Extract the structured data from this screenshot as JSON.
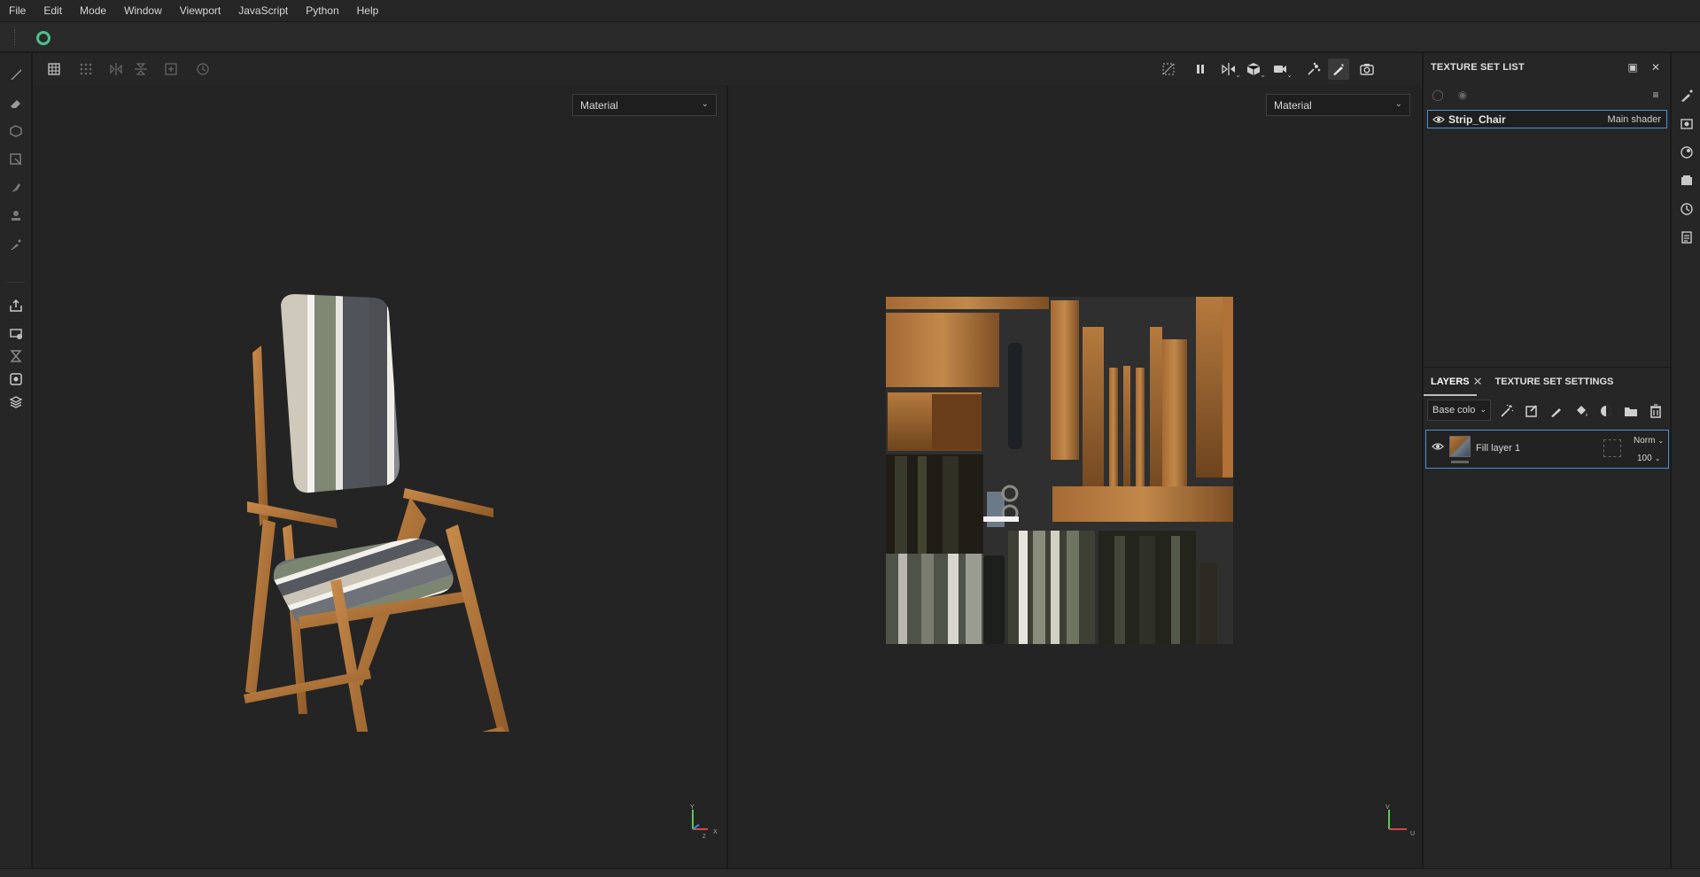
{
  "menubar": {
    "items": [
      "File",
      "Edit",
      "Mode",
      "Window",
      "Viewport",
      "JavaScript",
      "Python",
      "Help"
    ]
  },
  "viewport": {
    "left_mode": "Material",
    "right_mode": "Material",
    "left_axis": {
      "y": "Y",
      "x": "X",
      "z": "Z"
    },
    "right_axis": {
      "v": "V",
      "u": "U"
    }
  },
  "texture_set_list": {
    "title": "TEXTURE SET LIST",
    "items": [
      {
        "name": "Strip_Chair",
        "shader": "Main shader"
      }
    ]
  },
  "layers_panel": {
    "tabs": [
      "LAYERS",
      "TEXTURE SET SETTINGS"
    ],
    "channel": "Base colo",
    "layers": [
      {
        "name": "Fill layer 1",
        "blend": "Norm",
        "opacity": "100"
      }
    ]
  },
  "colors": {
    "accent": "#4a90d9",
    "logo": "#4fc08d",
    "background": "#242424"
  },
  "icons": {
    "left_tools": [
      "paint-brush-icon",
      "eraser-icon",
      "projection-icon",
      "polygon-fill-icon",
      "smudge-icon",
      "clone-stamp-icon",
      "color-picker-icon",
      "export-icon",
      "bake-icon",
      "geometry-mask-icon",
      "texture-set-icon",
      "display-settings-icon"
    ],
    "right_tools": [
      "pen-icon",
      "camera-settings-icon",
      "environment-icon",
      "shelf-icon",
      "history-icon",
      "log-icon"
    ]
  }
}
